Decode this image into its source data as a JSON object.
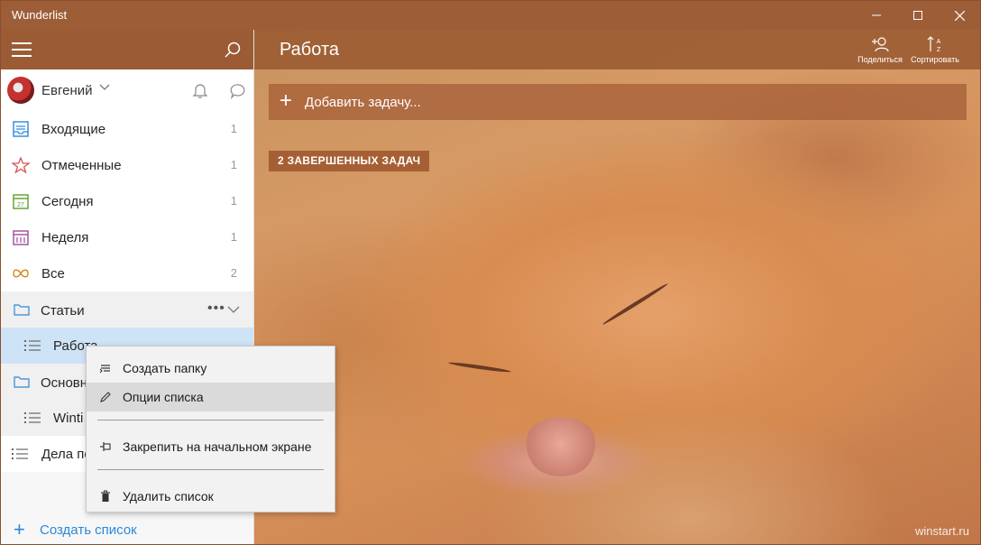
{
  "window": {
    "title": "Wunderlist"
  },
  "sidebar": {
    "user": {
      "name": "Евгений"
    },
    "smart_lists": [
      {
        "label": "Входящие",
        "count": "1",
        "icon": "inbox-icon"
      },
      {
        "label": "Отмеченные",
        "count": "1",
        "icon": "star-icon"
      },
      {
        "label": "Сегодня",
        "count": "1",
        "icon": "calendar-today-icon"
      },
      {
        "label": "Неделя",
        "count": "1",
        "icon": "calendar-week-icon"
      },
      {
        "label": "Все",
        "count": "2",
        "icon": "infinity-icon"
      }
    ],
    "folder1": {
      "label": "Статьи",
      "more": "•••"
    },
    "folder1_list": {
      "label": "Работа"
    },
    "folder2": {
      "label": "Основн"
    },
    "folder2_list": {
      "label": "Winti"
    },
    "list3": {
      "label": "Дела по"
    },
    "create_list": "Создать список"
  },
  "main": {
    "list_title": "Работа",
    "share_label": "Поделиться",
    "sort_label": "Сортировать",
    "add_task_placeholder": "Добавить задачу...",
    "completed_badge": "2 ЗАВЕРШЕННЫХ ЗАДАЧ",
    "watermark": "winstart.ru"
  },
  "context_menu": {
    "items": [
      {
        "label": "Создать папку",
        "icon": "create-folder-icon"
      },
      {
        "label": "Опции списка",
        "icon": "pencil-icon"
      },
      {
        "label": "Закрепить на начальном экране",
        "icon": "pin-icon"
      },
      {
        "label": "Удалить список",
        "icon": "trash-icon"
      }
    ]
  },
  "colors": {
    "accent": "#9b5b35",
    "link": "#2b88d8",
    "active_row": "#cfe3f7"
  }
}
